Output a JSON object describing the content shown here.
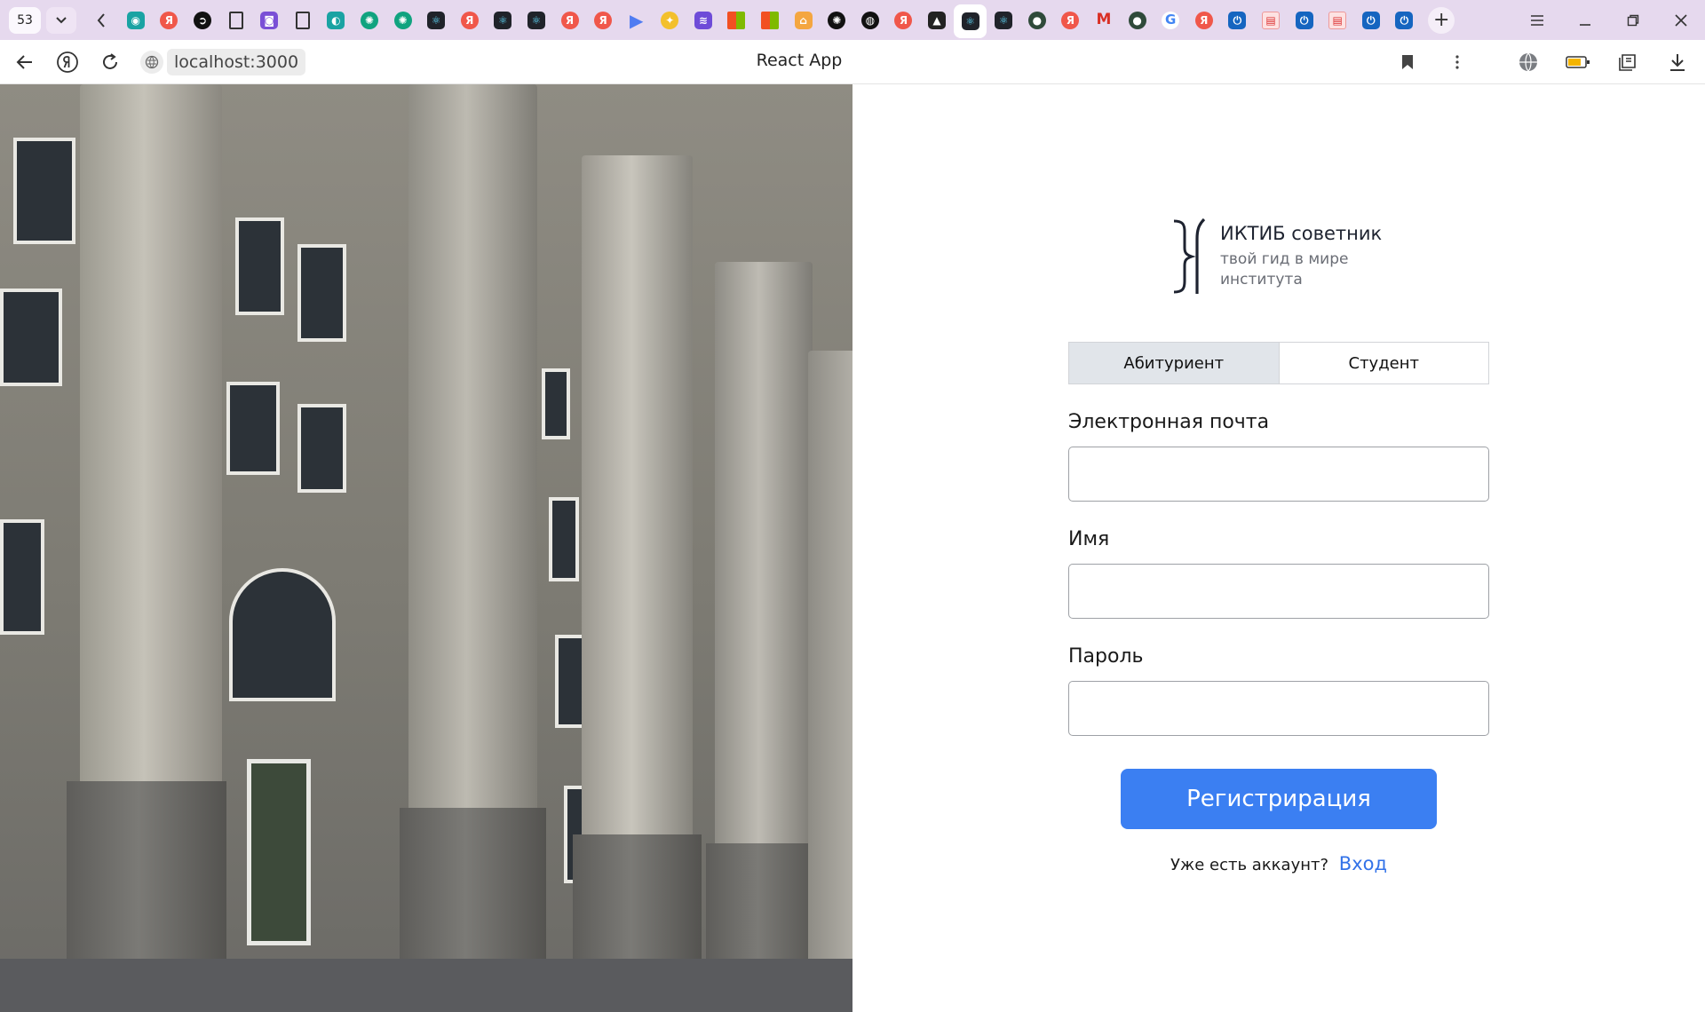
{
  "browser": {
    "tab_count": "53",
    "new_tab_symbol": "+",
    "tab_icons": [
      "ai-assistant",
      "yandex",
      "pinwheel",
      "doc",
      "purple-app",
      "doc",
      "teal-app",
      "chatgpt",
      "chatgpt",
      "react",
      "yandex",
      "react",
      "react",
      "yandex",
      "yandex",
      "play",
      "duck",
      "stack",
      "microsoft",
      "microsoft",
      "home",
      "openai",
      "github",
      "yandex",
      "image",
      "react",
      "react",
      "planet",
      "yandex",
      "gmail",
      "planet",
      "google",
      "yandex",
      "blue-power",
      "pdf",
      "blue-power",
      "pdf",
      "blue-power",
      "blue-power"
    ],
    "active_tab_index": 25,
    "address": "localhost:3000",
    "page_title": "React App"
  },
  "brand": {
    "title": "ИКТИБ советник",
    "subtitle": "твой гид в мире института"
  },
  "roles": {
    "applicant": "Абитуриент",
    "student": "Студент",
    "selected": "applicant"
  },
  "form": {
    "email_label": "Электронная почта",
    "email_value": "",
    "name_label": "Имя",
    "name_value": "",
    "password_label": "Пароль",
    "password_value": "",
    "submit_label": "Регистрирация"
  },
  "footer": {
    "question": "Уже есть аккаунт?",
    "login_link": "Вход"
  },
  "colors": {
    "tab_strip": "#e6d9ee",
    "primary": "#3b7ff2",
    "link": "#3272e8",
    "role_active": "#e1e5ea"
  }
}
